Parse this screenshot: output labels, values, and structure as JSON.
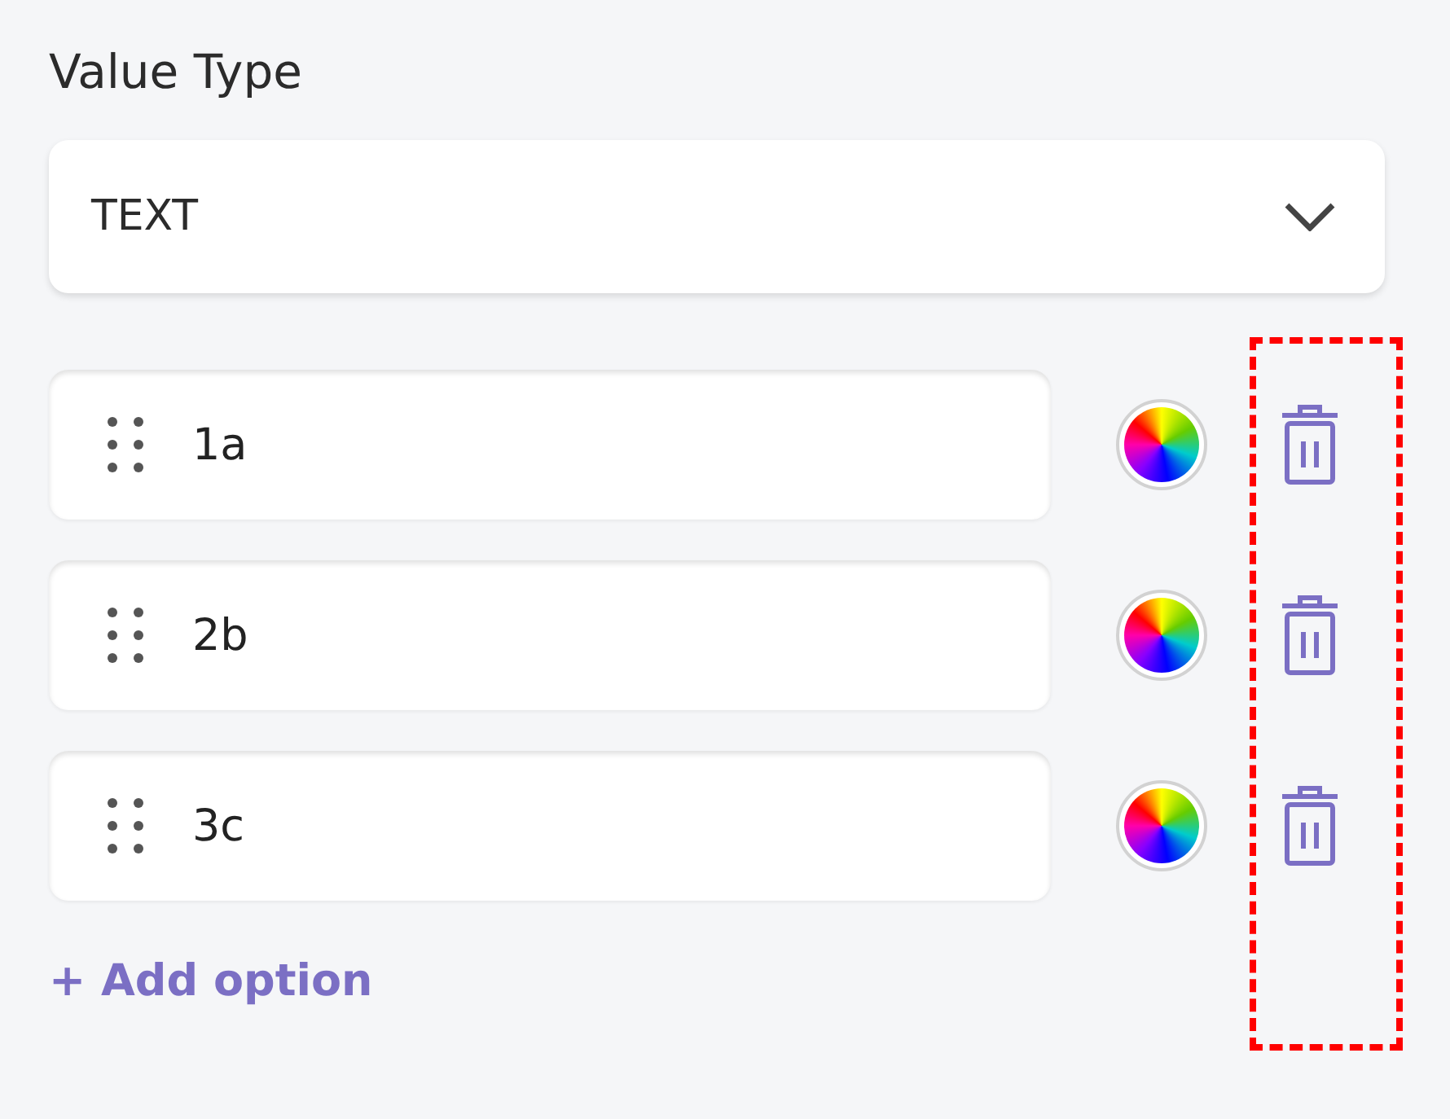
{
  "value_type": {
    "label": "Value Type",
    "value": "TEXT"
  },
  "options": [
    {
      "value": "1a"
    },
    {
      "value": "2b"
    },
    {
      "value": "3c"
    }
  ],
  "add_option": "+ Add option"
}
